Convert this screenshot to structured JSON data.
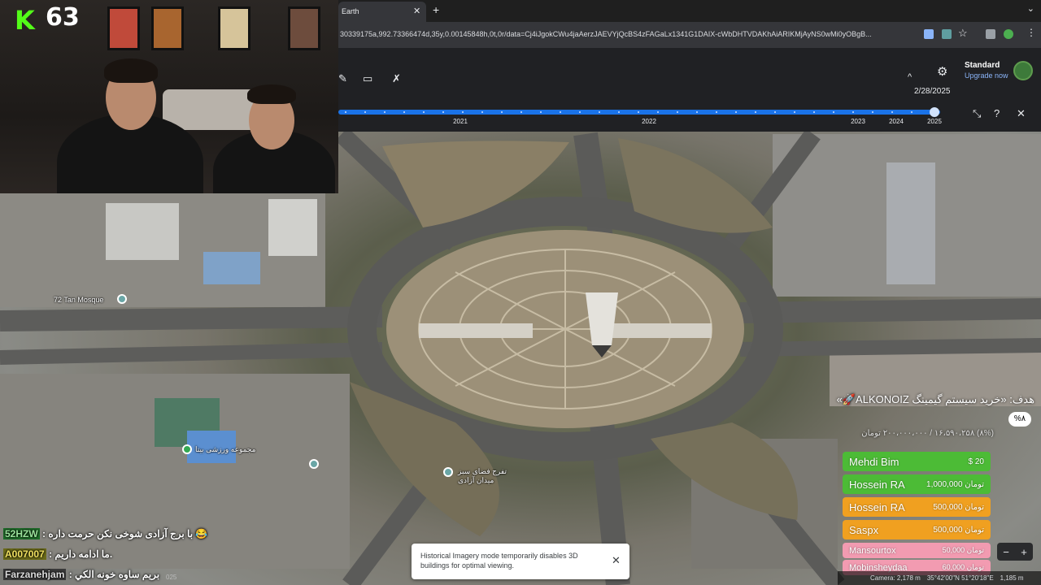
{
  "browser": {
    "tab_title": "Earth",
    "tab_close": "✕",
    "new_tab": "+",
    "tab_menu": "⌄",
    "url": "30339175a,992.73366474d,35y,0.00145848h,0t,0r/data=Cj4iJgokCWu4jaAerzJAEVYjQcBS4zFAGaLx1341G1DAIX-cWbDHTVDAKhAiARIKMjAyNS0wMi0yOBgB..."
  },
  "earth": {
    "plan": "Standard",
    "upgrade": "Upgrade now",
    "selected_date": "2/28/2025",
    "collapse": "^",
    "years": [
      "2021",
      "2022",
      "2023",
      "2024",
      "2025"
    ],
    "timeline_value": "2/28/2025"
  },
  "stream": {
    "platform_logo": "K",
    "viewer_count": "63"
  },
  "map_labels": {
    "mosque": "72 Tan Mosque",
    "complex": "مجموعه ورزشی بیتا",
    "tower": "تفرج فضای سبز میدان آزادی"
  },
  "goal": {
    "title": "هدف: «خرید سیستم گیمینگ ALKONOIZ🚀»",
    "subtitle": "(۸%) ۱۶،۵۹۰،۲۵۸ / ۲۰۰،۰۰۰،۰۰۰ تومان",
    "percent": "%۸"
  },
  "donations": [
    {
      "name": "Mehdi Bim",
      "amount": "$ 20",
      "color": "#4cbb36"
    },
    {
      "name": "Hossein RA",
      "amount": "1,000,000 تومان",
      "color": "#4cbb36"
    },
    {
      "name": "Hossein RA",
      "amount": "500,000 تومان",
      "color": "#f0a020"
    },
    {
      "name": "Saspx",
      "amount": "500,000 تومان",
      "color": "#f0a020"
    },
    {
      "name": "Mansourtox",
      "amount": "50,000 تومان",
      "color": "#f29bb1"
    },
    {
      "name": "Mobinsheydaa",
      "amount": "60,000 تومان",
      "color": "#f29bb1"
    }
  ],
  "chat": [
    {
      "user": "52HZW",
      "message": ": با برج آزادی شوخی نکن حرمت داره 😂",
      "user_bg": "#1f6f2a"
    },
    {
      "user": "A007007",
      "message": ": ما ادامه داریم.",
      "user_bg": "#6b6b1a"
    },
    {
      "user": "Farzanehjam",
      "message": ": بریم ساوه خونه الکي",
      "user_bg": "#3a3a3a"
    }
  ],
  "toast": {
    "text": "Historical Imagery mode temporarily disables 3D buildings for optimal viewing.",
    "close": "✕"
  },
  "status": {
    "camera": "Camera: 2,178 m",
    "coords": "35°42'00\"N 51°20'18\"E",
    "elevation": "1,185 m",
    "imagery": "025"
  },
  "zoom": {
    "minus": "−",
    "plus": "+"
  }
}
